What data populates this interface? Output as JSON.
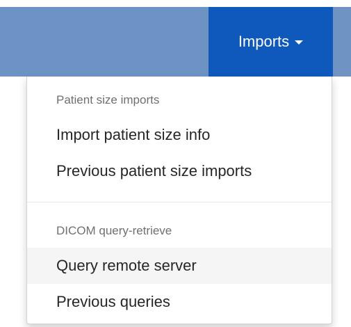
{
  "navbar": {
    "imports_label": "Imports",
    "imports_icon": "caret-down-icon",
    "colors": {
      "bar": "#6c93c4",
      "active_item": "#0f59bd",
      "text": "#ffffff"
    }
  },
  "dropdown": {
    "groups": [
      {
        "header": "Patient size imports",
        "items": [
          {
            "label": "Import patient size info"
          },
          {
            "label": "Previous patient size imports"
          }
        ]
      },
      {
        "header": "DICOM query-retrieve",
        "items": [
          {
            "label": "Query remote server",
            "hovered": true
          },
          {
            "label": "Previous queries"
          }
        ]
      }
    ]
  }
}
